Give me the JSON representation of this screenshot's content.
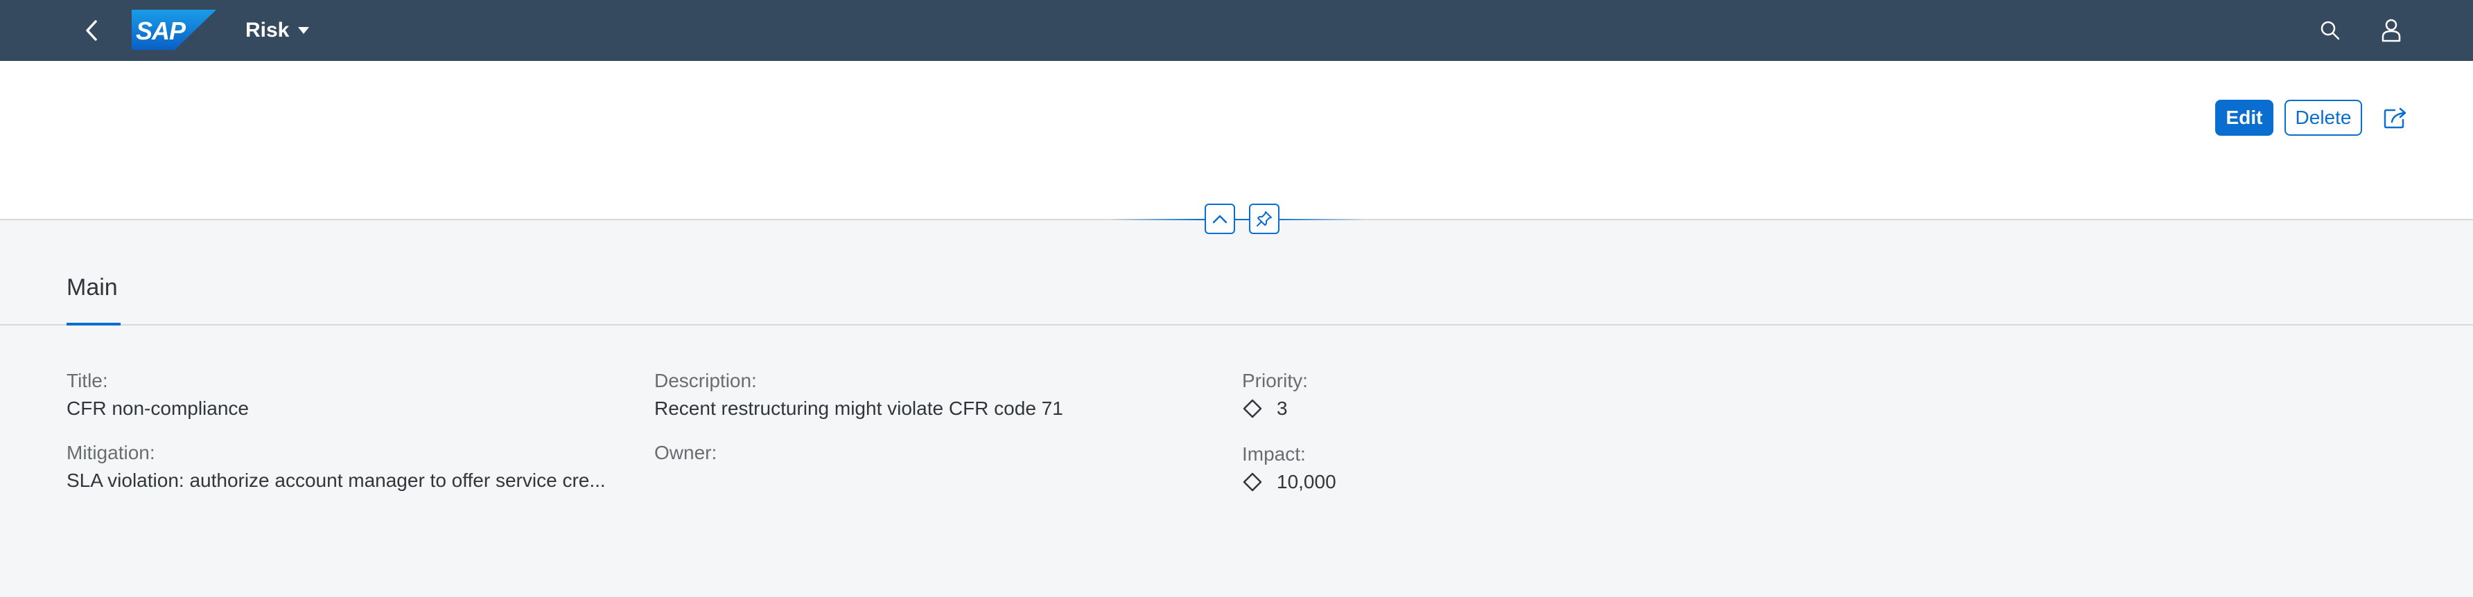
{
  "shell": {
    "title": "Risk",
    "logo_text": "SAP",
    "icons": {
      "back": "back-arrow-icon",
      "title_menu": "caret-down-icon",
      "search": "search-icon",
      "user": "user-icon"
    },
    "colors": {
      "bar_background": "#354a5f",
      "logo_blue": "#1a9ce8"
    }
  },
  "header": {
    "actions": {
      "edit_label": "Edit",
      "delete_label": "Delete",
      "share_icon": "share-icon"
    },
    "collapse_icon": "chevron-up-icon",
    "pin_icon": "pin-icon",
    "accent_color": "#0a6ed1"
  },
  "tabs": [
    {
      "label": "Main",
      "selected": true
    }
  ],
  "fields": {
    "title": {
      "label": "Title:",
      "value": "CFR non-compliance"
    },
    "description": {
      "label": "Description:",
      "value": "Recent restructuring might violate CFR code 71"
    },
    "priority": {
      "label": "Priority:",
      "value": "3"
    },
    "mitigation": {
      "label": "Mitigation:",
      "value": "SLA violation: authorize account manager to offer service cre..."
    },
    "owner": {
      "label": "Owner:",
      "value": ""
    },
    "impact": {
      "label": "Impact:",
      "value": "10,000"
    }
  }
}
